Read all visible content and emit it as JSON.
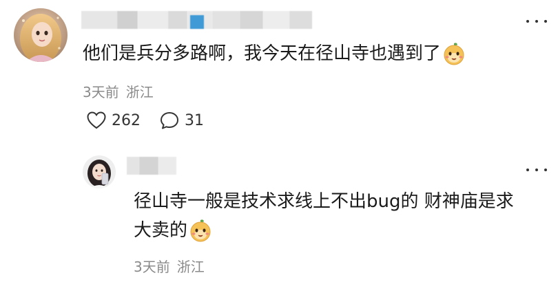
{
  "comment": {
    "text": "他们是兵分多路啊，我今天在径山寺也遇到了",
    "emoji_icon": "cute-face-emoji-icon",
    "time": "3天前",
    "location": "浙江",
    "likes": "262",
    "replies": "31"
  },
  "reply": {
    "text_line1": "径山寺一般是技术求线上不出bug的 财神庙是求",
    "text_line2": "大卖的",
    "emoji_icon": "cute-face-emoji-icon",
    "time": "3天前",
    "location": "浙江"
  },
  "icons": {
    "like": "heart-icon",
    "reply": "speech-bubble-icon",
    "more": "more-dots-icon"
  },
  "colors": {
    "meta_gray": "#8a8a8a",
    "text": "#1a1a1a",
    "redaction_blue": "#3f9ad6"
  }
}
